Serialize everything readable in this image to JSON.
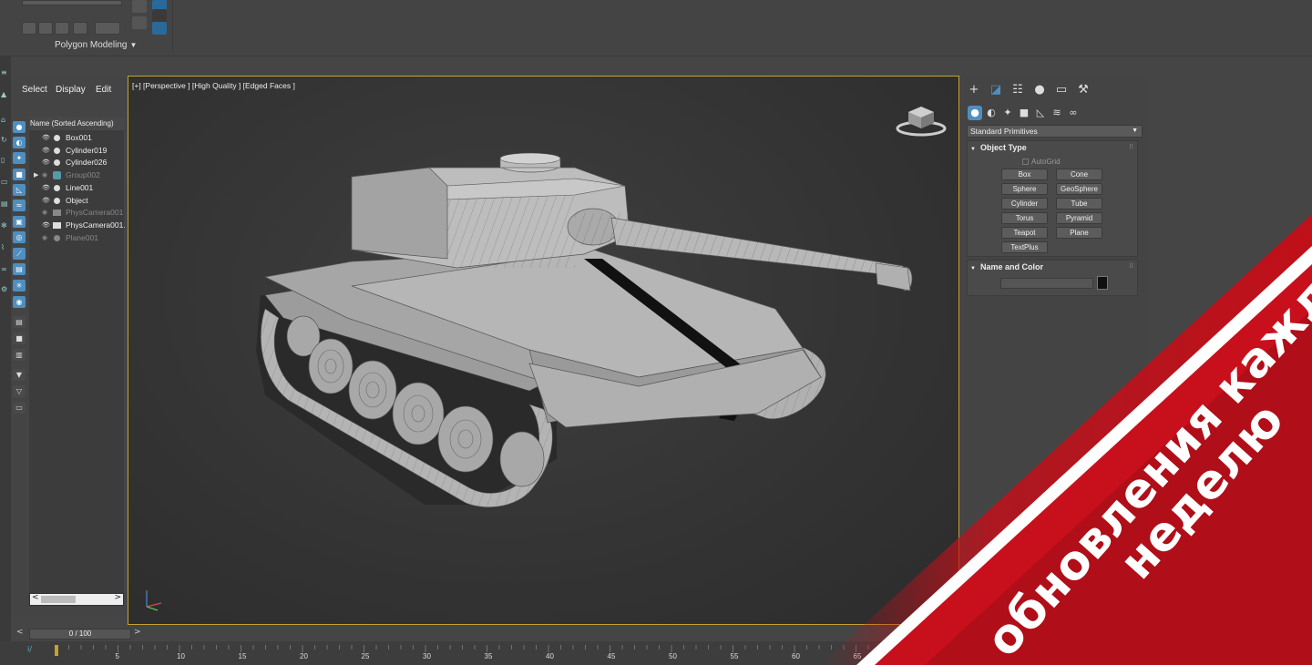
{
  "ribbon": {
    "group_label": "Polygon Modeling"
  },
  "explorer": {
    "menu": {
      "select": "Select",
      "display": "Display",
      "edit": "Edit"
    },
    "list_header": "Name (Sorted Ascending)",
    "items": [
      {
        "name": "Box001",
        "kind": "object",
        "visible": true,
        "dim": false
      },
      {
        "name": "Cylinder019",
        "kind": "object",
        "visible": true,
        "dim": false
      },
      {
        "name": "Cylinder026",
        "kind": "object",
        "visible": true,
        "dim": false
      },
      {
        "name": "Group002",
        "kind": "group",
        "visible": false,
        "dim": true
      },
      {
        "name": "Line001",
        "kind": "shape",
        "visible": true,
        "dim": false
      },
      {
        "name": "Object",
        "kind": "object",
        "visible": true,
        "dim": false
      },
      {
        "name": "PhysCamera001",
        "kind": "camera",
        "visible": false,
        "dim": true
      },
      {
        "name": "PhysCamera001.",
        "kind": "camera",
        "visible": true,
        "dim": false
      },
      {
        "name": "Plane001",
        "kind": "object",
        "visible": false,
        "dim": true
      }
    ]
  },
  "viewport": {
    "label": "[+] [Perspective ] [High Quality ] [Edged Faces ]"
  },
  "command_panel": {
    "dropdown": "Standard Primitives",
    "object_type": {
      "title": "Object Type",
      "autogrid": "AutoGrid",
      "buttons": [
        "Box",
        "Cone",
        "Sphere",
        "GeoSphere",
        "Cylinder",
        "Tube",
        "Torus",
        "Pyramid",
        "Teapot",
        "Plane",
        "TextPlus"
      ]
    },
    "name_color": {
      "title": "Name and Color"
    }
  },
  "timeline": {
    "slider": "0 / 100",
    "ticks": [
      "5",
      "10",
      "15",
      "20",
      "25",
      "30",
      "35",
      "40",
      "45",
      "50",
      "55",
      "60",
      "65"
    ]
  },
  "banner": {
    "line1": "обновления каждую",
    "line2": "неделю"
  },
  "colors": {
    "accent": "#4f8fc0",
    "viewport_border": "#c8a030",
    "banner_red": "#c0101a"
  }
}
